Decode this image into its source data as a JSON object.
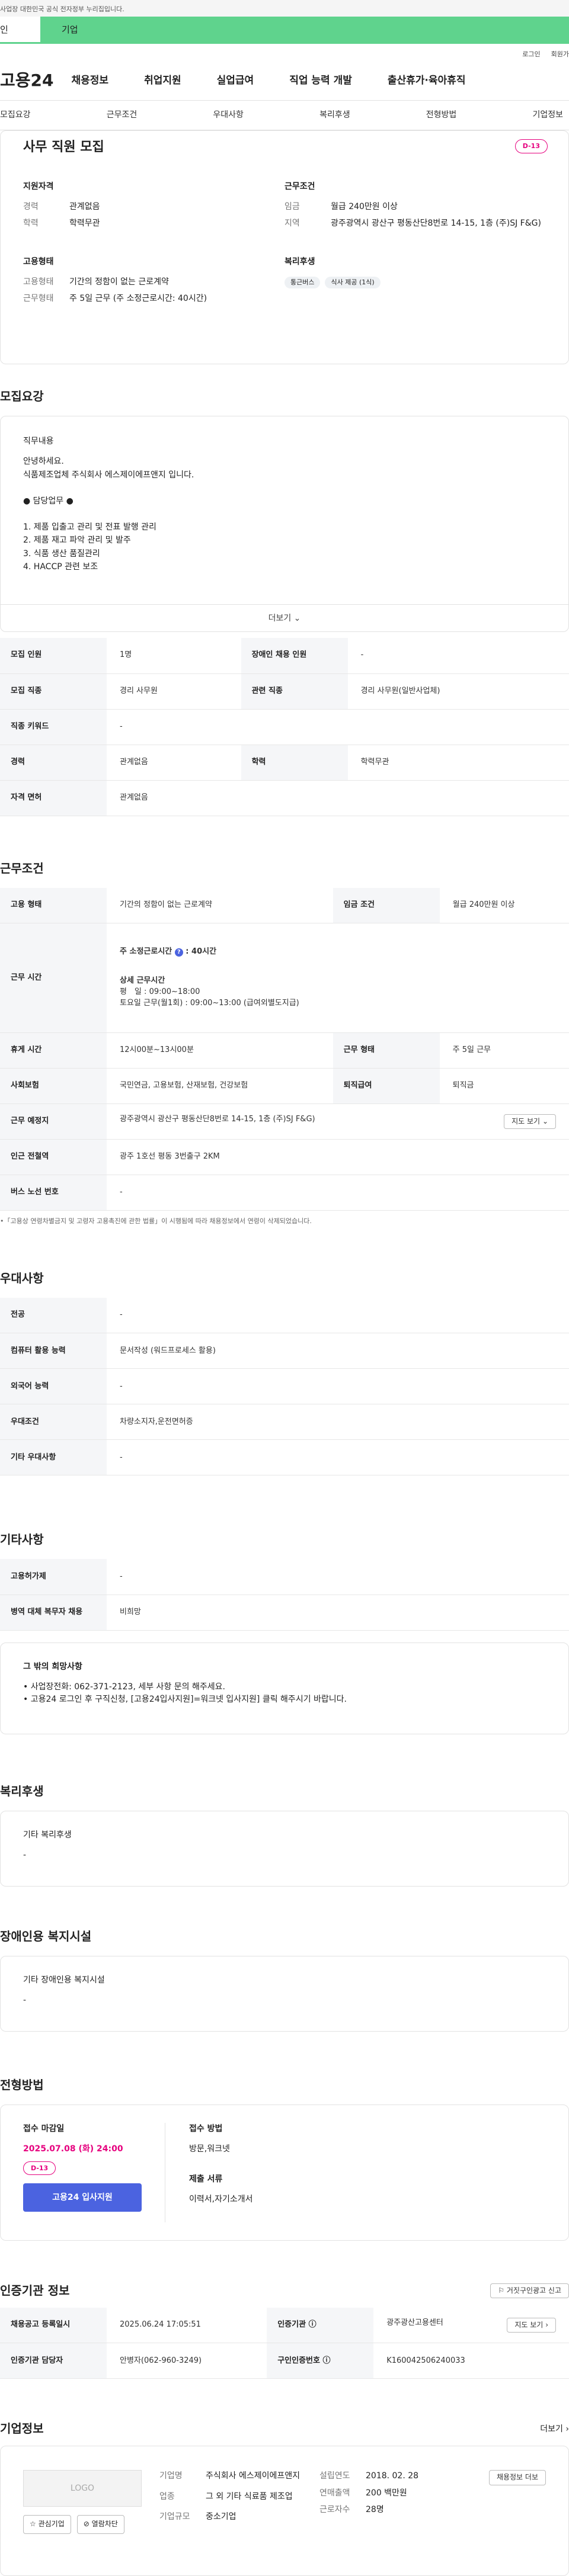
{
  "topbar": {
    "notice": "사업장 대한민국 공식 전자정부 누리집입니다."
  },
  "tabs": {
    "individual": "인",
    "business": "기업"
  },
  "util": {
    "login": "로그인",
    "signup": "회원가"
  },
  "gnb": {
    "logo": "고용24",
    "items": [
      "채용정보",
      "취업지원",
      "실업급여",
      "직업 능력 개발",
      "출산휴가·육아휴직"
    ]
  },
  "subnav": [
    "모집요강",
    "근무조건",
    "우대사항",
    "복리후생",
    "전형방법",
    "기업정보"
  ],
  "summary": {
    "title": "사무 직원 모집",
    "dday": "D-13",
    "qual_h": "지원자격",
    "qual": [
      [
        "경력",
        "관계없음"
      ],
      [
        "학력",
        "학력무관"
      ]
    ],
    "cond_h": "근무조건",
    "cond": [
      [
        "임금",
        "월급 240만원 이상"
      ],
      [
        "지역",
        "광주광역시 광산구 평동산단8번로 14-15, 1층 (주)SJ F&G)"
      ]
    ],
    "emp_h": "고용형태",
    "emp": [
      [
        "고용형태",
        "기간의 정함이 없는 근로계약"
      ],
      [
        "근무형태",
        "주 5일 근무 (주 소정근로시간: 40시간)"
      ]
    ],
    "welfare_h": "복리후생",
    "welfare": [
      "통근버스",
      "식사 제공 (1식)"
    ]
  },
  "req": {
    "h": "모집요강",
    "desc_h": "직무내용",
    "lines": [
      "안녕하세요.",
      "식품제조업체 주식회사 에스제이에프앤지 입니다.",
      "",
      "● 담당업무 ●",
      "",
      "1. 제품 입출고 관리 및 전표 발행 관리",
      "2. 제품 재고 파악 관리 및 발주",
      "3. 식품 생산 품질관리",
      "4. HACCP 관련 보조"
    ],
    "more": "더보기",
    "rows": [
      [
        "모집 인원",
        "1명",
        "장애인 채용 인원",
        "-"
      ],
      [
        "모집 직종",
        "경리 사무원",
        "관련 직종",
        "경리 사무원(일반사업체)"
      ],
      [
        "직종 키워드",
        "-"
      ],
      [
        "경력",
        "관계없음",
        "학력",
        "학력무관"
      ],
      [
        "자격 면허",
        "관계없음"
      ]
    ]
  },
  "work": {
    "h": "근무조건",
    "emp_type_k": "고용 형태",
    "emp_type_v": "기간의 정함이 없는 근로계약",
    "wage_k": "임금 조건",
    "wage_v": "월급 240만원 이상",
    "time_k": "근무 시간",
    "time_main": "주 소정근로시간",
    "time_hours": "40시간",
    "time_detail_h": "상세 근무시간",
    "time_d1": "평　일 : 09:00~18:00",
    "time_d2": "토요일 근무(월1회) : 09:00~13:00 (급여외별도지급)",
    "rest_k": "휴게 시간",
    "rest_v": "12시00분~13시00분",
    "form_k": "근무 형태",
    "form_v": "주 5일 근무",
    "ins_k": "사회보험",
    "ins_v": "국민연금, 고용보험, 산재보험, 건강보험",
    "ret_k": "퇴직급여",
    "ret_v": "퇴직금",
    "place_k": "근무 예정지",
    "place_v": "광주광역시 광산구 평동산단8번로 14-15, 1층 (주)SJ F&G)",
    "map": "지도 보기",
    "sub_k": "인근 전철역",
    "sub_v": "광주 1호선 평동 3번출구 2KM",
    "bus_k": "버스 노선 번호",
    "bus_v": "-",
    "note": "•「고용상 연령차별금지 및 고령자 고용촉진에 관한 법률」이 시행됨에 따라 채용정보에서 연령이 삭제되었습니다."
  },
  "pref": {
    "h": "우대사항",
    "rows": [
      [
        "전공",
        "-"
      ],
      [
        "컴퓨터 활용 능력",
        "문서작성 (워드프로세스 활용)"
      ],
      [
        "외국어 능력",
        "-"
      ],
      [
        "우대조건",
        "차량소지자,운전면허증"
      ],
      [
        "기타 우대사항",
        "-"
      ]
    ]
  },
  "etc": {
    "h": "기타사항",
    "rows": [
      [
        "고용허가제",
        "-"
      ],
      [
        "병역 대체 복무자 채용",
        "비희망"
      ]
    ],
    "box_h": "그 밖의 희망사항",
    "box_lines": [
      "• 사업장전화: 062-371-2123, 세부 사항 문의 해주세요.",
      "• 고용24 로그인 후 구직신청, [고용24입사지원]=워크넷 입사지원] 클릭 해주시기 바랍니다."
    ]
  },
  "welfare": {
    "h": "복리후생",
    "box_h": "기타 복리후생",
    "box_v": "-"
  },
  "disab": {
    "h": "장애인용 복지시설",
    "box_h": "기타 장애인용 복지시설",
    "box_v": "-"
  },
  "select": {
    "h": "전형방법",
    "deadline_h": "접수 마감일",
    "deadline": "2025.07.08 (화) 24:00",
    "dday": "D-13",
    "apply": "고용24 입사지원",
    "method_h": "접수 방법",
    "method": "방문,워크넷",
    "docs_h": "제출 서류",
    "docs": "이력서,자기소개서"
  },
  "cert": {
    "h": "인증기관 정보",
    "report": "거짓구인광고 신고",
    "reg_k": "채용공고 등록일시",
    "reg_v": "2025.06.24 17:05:51",
    "org_k": "인증기관",
    "org_v": "광주광산고용센터",
    "map": "지도 보기",
    "staff_k": "인증기관 담당자",
    "staff_v": "안병자(062-960-3249)",
    "id_k": "구인인증번호",
    "id_v": "K160042506240033"
  },
  "company": {
    "h": "기업정보",
    "more": "더보기",
    "logo": "LOGO",
    "fav": "관심기업",
    "block": "열람차단",
    "name_k": "기업명",
    "name_v": "주식회사 에스제이에프앤지",
    "ind_k": "업종",
    "ind_v": "그 외 기타 식료품 제조업",
    "size_k": "기업규모",
    "size_v": "중소기업",
    "est_k": "설립연도",
    "est_v": "2018. 02. 28",
    "sales_k": "연매출액",
    "sales_v": "200 백만원",
    "emp_k": "근로자수",
    "emp_v": "28명",
    "info_btn": "채용정보 더보"
  }
}
